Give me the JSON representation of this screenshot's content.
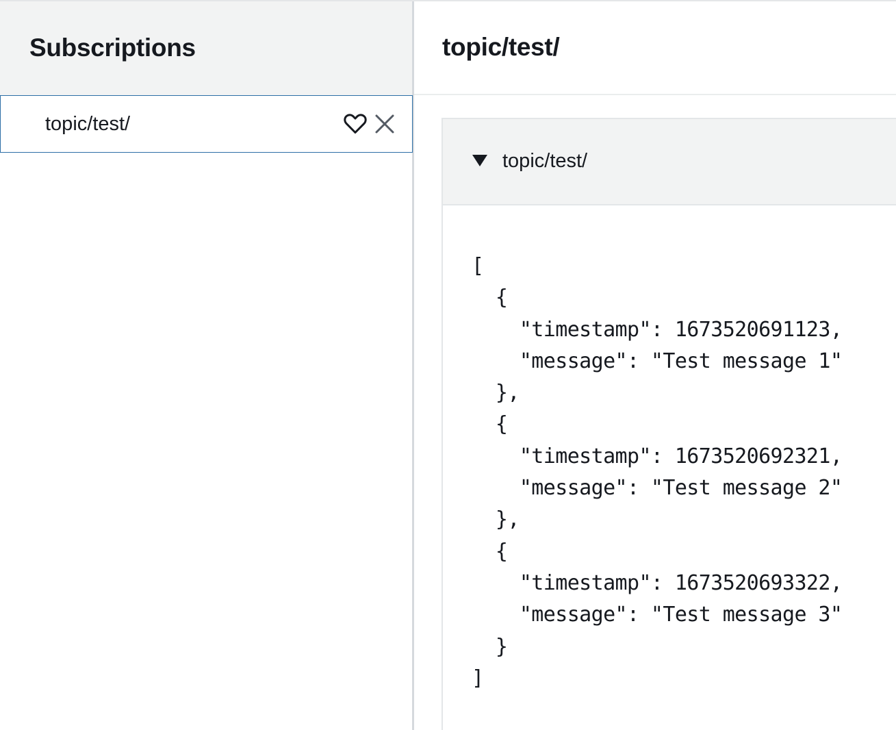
{
  "subscriptions": {
    "title": "Subscriptions",
    "items": [
      {
        "topic": "topic/test/",
        "favorite_icon": "heart-outline-icon",
        "remove_icon": "close-icon"
      }
    ]
  },
  "topic_view": {
    "title": "topic/test/",
    "message": {
      "topic": "topic/test/",
      "expanded": true,
      "payload": "[\n  {\n    \"timestamp\": 1673520691123,\n    \"message\": \"Test message 1\"\n  },\n  {\n    \"timestamp\": 1673520692321,\n    \"message\": \"Test message 2\"\n  },\n  {\n    \"timestamp\": 1673520693322,\n    \"message\": \"Test message 3\"\n  }\n]"
    }
  },
  "colors": {
    "header_bg": "#f2f3f3",
    "selected_border": "#2c6ea6",
    "text": "#16191f"
  }
}
